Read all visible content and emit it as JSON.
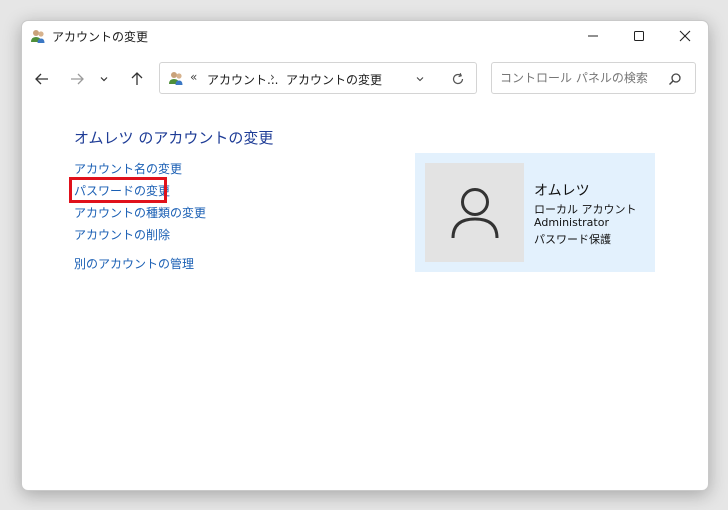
{
  "window": {
    "title": "アカウントの変更"
  },
  "address": {
    "overflow_chevron": "«",
    "crumb1": "アカウント...",
    "separator": "›",
    "crumb2": "アカウントの変更"
  },
  "search": {
    "placeholder": "コントロール パネルの検索",
    "value": ""
  },
  "main": {
    "title": "オムレツ のアカウントの変更",
    "links": {
      "change_name": "アカウント名の変更",
      "change_password": "パスワードの変更",
      "change_type": "アカウントの種類の変更",
      "delete_account": "アカウントの削除",
      "manage_other": "別のアカウントの管理"
    }
  },
  "user": {
    "name": "オムレツ",
    "account_type": "ローカル アカウント",
    "role": "Administrator",
    "password_status": "パスワード保護"
  },
  "icons": {
    "title": "users-icon",
    "back": "arrow-left-icon",
    "forward": "arrow-right-icon",
    "recent": "chevron-down-icon",
    "up": "arrow-up-icon",
    "refresh": "refresh-icon",
    "search": "search-icon",
    "minimize": "minimize-icon",
    "maximize": "maximize-icon",
    "close": "close-icon",
    "avatar": "user-avatar-icon"
  },
  "colors": {
    "link": "#1a5fb4",
    "title": "#1e3c96",
    "highlight": "#e0111b",
    "user_panel_bg": "#e3f1fd"
  }
}
